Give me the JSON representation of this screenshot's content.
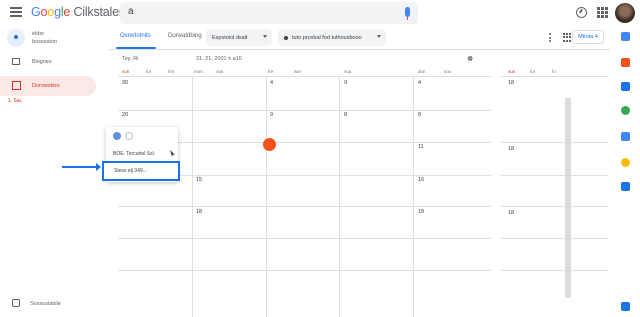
{
  "app": {
    "logo_prefix": "Google",
    "logo_suffix": " Cilkstaler"
  },
  "search": {
    "glyph": "a"
  },
  "sidebar": {
    "account_line1": "elder",
    "account_line2": "bosseston",
    "items": [
      {
        "label": "Bsignes"
      },
      {
        "label": "Dorowsters"
      }
    ],
    "sub_label": "1. Sai,",
    "footer_label": "Sossosiabile"
  },
  "toolbar": {
    "tabs": [
      {
        "label": "Oxrerlotnits"
      },
      {
        "label": "Dorwatdbing"
      }
    ],
    "chip1": "Expstoiol dsalt",
    "chip2": "tuto proxbal fod tuthousbooo",
    "share_label": "Mtrsta 4"
  },
  "calendar": {
    "caption_left": "Tey. Ri",
    "caption_mid": "31. 21, 2001  ± a10",
    "caption_right": "☸",
    "dow": [
      "sun",
      "fol",
      "hrs",
      "mon",
      "ous",
      "fre",
      "wer",
      "suu",
      "dun",
      "soo"
    ],
    "weeks": [
      [
        "30",
        "",
        "",
        "",
        "4",
        "",
        "",
        ""
      ],
      [
        "20",
        "",
        "9",
        "",
        "8",
        "",
        "",
        ""
      ],
      [
        "",
        "",
        "9",
        "",
        "11",
        "",
        "",
        ""
      ],
      [
        "",
        "",
        "15",
        "",
        "16",
        "",
        "",
        ""
      ],
      [
        "",
        "",
        "18",
        "",
        "18",
        "",
        "",
        ""
      ],
      [
        "",
        "",
        "",
        "",
        "",
        "",
        "",
        ""
      ]
    ],
    "col_nums": {
      "row1": [
        "30",
        "",
        "4",
        "",
        "9",
        "",
        "4",
        ""
      ],
      "row2": [
        "20",
        "",
        "9",
        "",
        "8",
        "",
        "8",
        ""
      ],
      "row3": [
        "",
        "",
        "9",
        "",
        "",
        "",
        "11",
        ""
      ],
      "row4": [
        "",
        "15",
        "",
        "",
        "",
        "",
        "16",
        ""
      ],
      "row5": [
        "",
        "18",
        "",
        "",
        "",
        "",
        "18",
        ""
      ],
      "row6": [
        "",
        "",
        "",
        "",
        "",
        "",
        "",
        ""
      ]
    }
  },
  "right_panel": {
    "dow": [
      "sun",
      "fol",
      "fo"
    ],
    "nums": [
      "18",
      "",
      "",
      "18",
      "",
      "18"
    ]
  },
  "popup": {
    "line": "BOE. Tercurtel Ssl."
  },
  "highlight": {
    "text": "Stess elj 349..."
  },
  "colors": {
    "accent": "#1a73e8",
    "event_dot": "#f4511e",
    "today": "#d93025"
  }
}
